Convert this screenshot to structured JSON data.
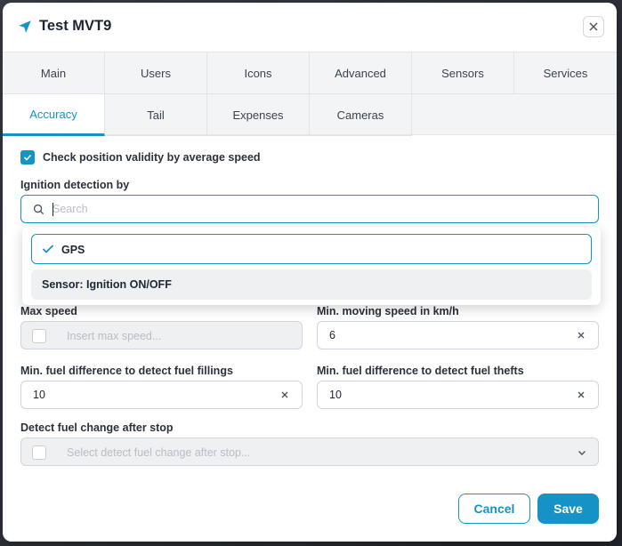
{
  "header": {
    "title": "Test MVT9"
  },
  "tabs_row1": [
    "Main",
    "Users",
    "Icons",
    "Advanced",
    "Sensors",
    "Services"
  ],
  "tabs_row2": [
    "Accuracy",
    "Tail",
    "Expenses",
    "Cameras"
  ],
  "active_tab": "Accuracy",
  "form": {
    "check_validity_label": "Check position validity by average speed",
    "ignition_label": "Ignition detection by",
    "search_placeholder": "Search",
    "options": [
      "GPS",
      "Sensor: Ignition ON/OFF"
    ],
    "selected_option": "GPS",
    "max_speed_label": "Max speed",
    "max_speed_placeholder": "Insert max speed...",
    "min_moving_label": "Min. moving speed in km/h",
    "min_moving_value": "6",
    "fuel_fill_label": "Min. fuel difference to detect fuel fillings",
    "fuel_fill_value": "10",
    "fuel_theft_label": "Min. fuel difference to detect fuel thefts",
    "fuel_theft_value": "10",
    "detect_fuel_label": "Detect fuel change after stop",
    "detect_fuel_placeholder": "Select detect fuel change after stop..."
  },
  "buttons": {
    "cancel": "Cancel",
    "save": "Save"
  },
  "colors": {
    "accent": "#1593c7"
  }
}
